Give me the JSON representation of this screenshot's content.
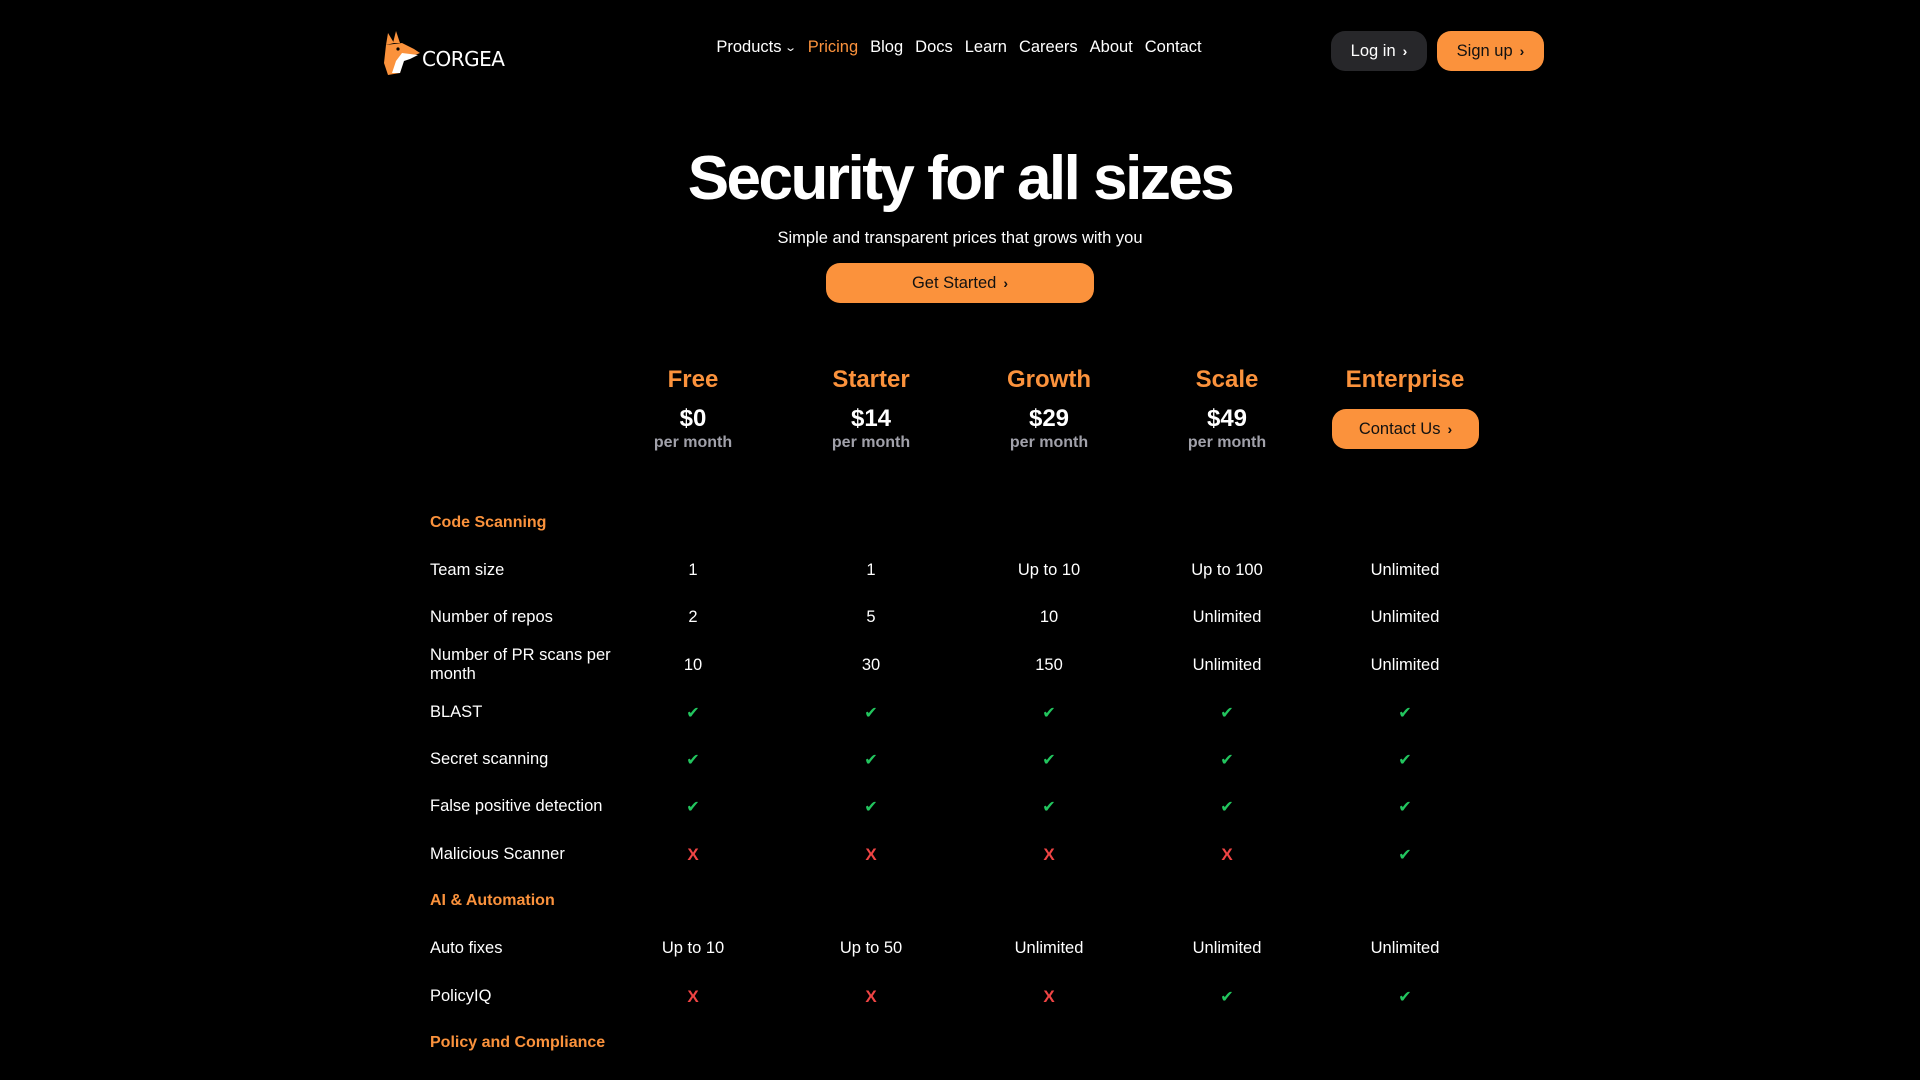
{
  "brand": {
    "name": "CORGEA"
  },
  "nav": {
    "items": [
      {
        "label": "Products",
        "has_dropdown": true
      },
      {
        "label": "Pricing",
        "active": true
      },
      {
        "label": "Blog"
      },
      {
        "label": "Docs"
      },
      {
        "label": "Learn"
      },
      {
        "label": "Careers"
      },
      {
        "label": "About"
      },
      {
        "label": "Contact"
      }
    ],
    "login_label": "Log in",
    "signup_label": "Sign up"
  },
  "hero": {
    "title": "Security for all sizes",
    "subtitle": "Simple and transparent prices that grows with you",
    "cta_label": "Get Started"
  },
  "plans": [
    {
      "name": "Free",
      "price": "$0",
      "period": "per month"
    },
    {
      "name": "Starter",
      "price": "$14",
      "period": "per month"
    },
    {
      "name": "Growth",
      "price": "$29",
      "period": "per month"
    },
    {
      "name": "Scale",
      "price": "$49",
      "period": "per month"
    },
    {
      "name": "Enterprise",
      "cta_label": "Contact Us"
    }
  ],
  "sections": {
    "code_scanning": {
      "title": "Code Scanning",
      "rows": {
        "team_size": {
          "label": "Team size",
          "values": [
            "1",
            "1",
            "Up to 10",
            "Up to 100",
            "Unlimited"
          ]
        },
        "repos": {
          "label": "Number of repos",
          "values": [
            "2",
            "5",
            "10",
            "Unlimited",
            "Unlimited"
          ]
        },
        "pr_scans": {
          "label": "Number of PR scans per month",
          "values": [
            "10",
            "30",
            "150",
            "Unlimited",
            "Unlimited"
          ]
        },
        "blast": {
          "label": "BLAST",
          "values": [
            "✔",
            "✔",
            "✔",
            "✔",
            "✔"
          ]
        },
        "secret": {
          "label": "Secret scanning",
          "values": [
            "✔",
            "✔",
            "✔",
            "✔",
            "✔"
          ]
        },
        "false_positive": {
          "label": "False positive detection",
          "values": [
            "✔",
            "✔",
            "✔",
            "✔",
            "✔"
          ]
        },
        "malicious": {
          "label": "Malicious Scanner",
          "values": [
            "X",
            "X",
            "X",
            "X",
            "✔"
          ]
        }
      }
    },
    "ai_automation": {
      "title": "AI & Automation",
      "rows": {
        "auto_fixes": {
          "label": "Auto fixes",
          "values": [
            "Up to 10",
            "Up to 50",
            "Unlimited",
            "Unlimited",
            "Unlimited"
          ]
        },
        "policyiq": {
          "label": "PolicyIQ",
          "values": [
            "X",
            "X",
            "X",
            "✔",
            "✔"
          ]
        }
      }
    },
    "policy_compliance": {
      "title": "Policy and Compliance"
    }
  },
  "colors": {
    "accent": "#fb923c",
    "background": "#000000",
    "check": "#22c55e",
    "cross": "#ef4444",
    "dark_button": "#27272a"
  },
  "icons": {
    "logo": "fox-icon",
    "chevron": "chevron-down-icon",
    "arrow": "chevron-right-icon",
    "check": "check-icon",
    "cross": "cross-icon"
  }
}
